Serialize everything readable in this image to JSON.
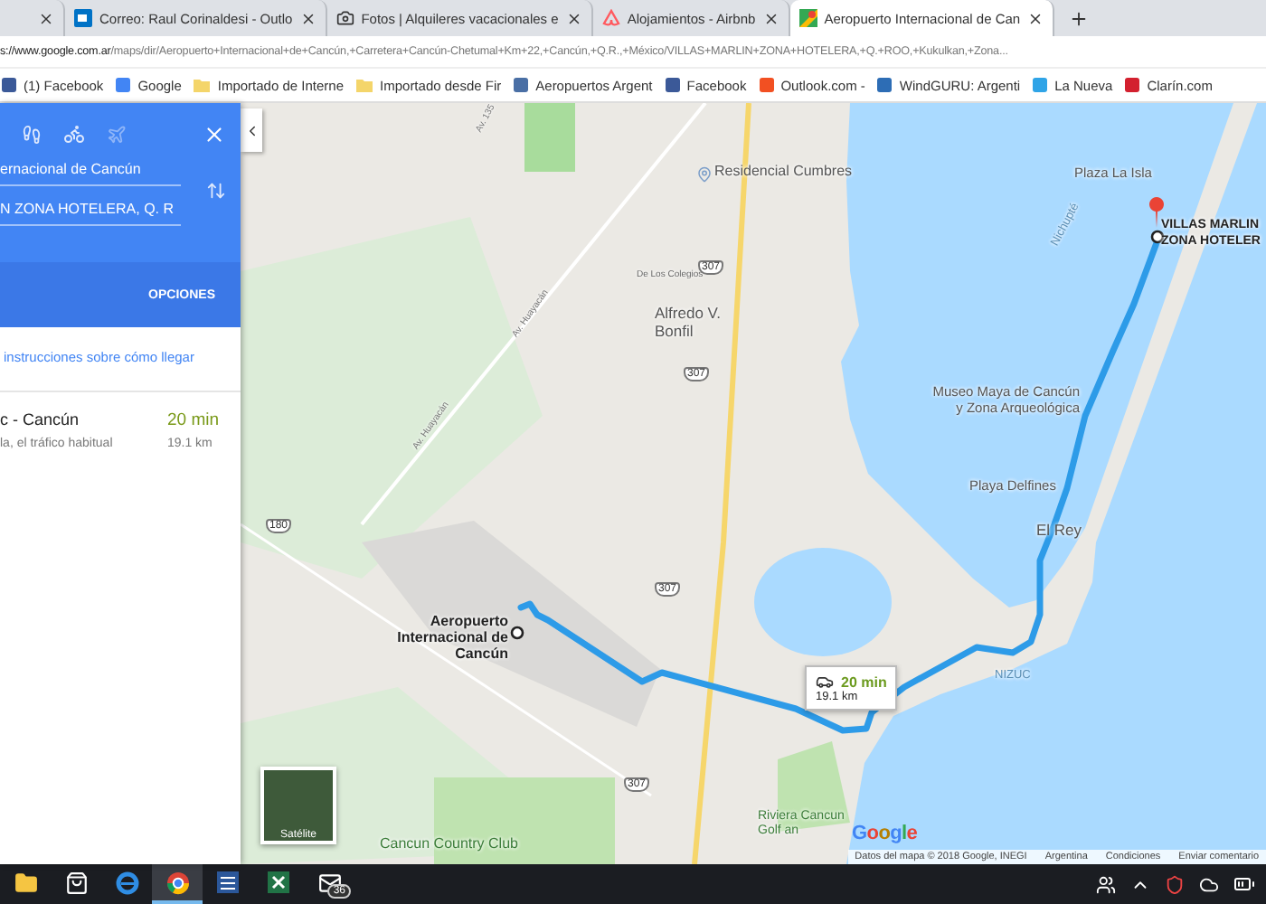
{
  "browser": {
    "tabs": [
      {
        "kind": "blank",
        "selected": false
      },
      {
        "kind": "mail",
        "title": "Correo: Raul Corinaldesi - Outlo",
        "selected": false
      },
      {
        "kind": "camera",
        "title": "Fotos | Alquileres vacacionales e",
        "selected": false
      },
      {
        "kind": "airbnb",
        "title": "Alojamientos - Airbnb",
        "selected": false
      },
      {
        "kind": "maps",
        "title": "Aeropuerto Internacional de Can",
        "selected": true
      }
    ],
    "address": {
      "host": "s://www.google.com.ar",
      "path": "/maps/dir/Aeropuerto+Internacional+de+Cancún,+Carretera+Cancún-Chetumal+Km+22,+Cancún,+Q.R.,+México/VILLAS+MARLIN+ZONA+HOTELERA,+Q.+ROO,+Kukulkan,+Zona..."
    },
    "bookmarks": [
      {
        "label": "(1) Facebook",
        "kind": "site",
        "color": "#3b5998"
      },
      {
        "label": "Google",
        "kind": "site",
        "color": "#4285f4"
      },
      {
        "label": "Importado de Interne",
        "kind": "folder",
        "color": "#f4d56a"
      },
      {
        "label": "Importado desde Fir",
        "kind": "folder",
        "color": "#f4d56a"
      },
      {
        "label": "Aeropuertos Argent",
        "kind": "site",
        "color": "#4a6fa5"
      },
      {
        "label": "Facebook",
        "kind": "site",
        "color": "#3b5998"
      },
      {
        "label": "Outlook.com -",
        "kind": "site",
        "color": "#f25022"
      },
      {
        "label": "WindGURU: Argenti",
        "kind": "site",
        "color": "#2d6db5"
      },
      {
        "label": "La Nueva",
        "kind": "site",
        "color": "#2fa4e7"
      },
      {
        "label": "Clarín.com",
        "kind": "site",
        "color": "#d3202f"
      }
    ]
  },
  "directions": {
    "modes": [
      {
        "kind": "walk",
        "selected": false
      },
      {
        "kind": "bike",
        "selected": false
      },
      {
        "kind": "plane",
        "selected": false
      }
    ],
    "origin": "ernacional de Cancún",
    "destination": "N ZONA HOTELERA, Q. R",
    "options": "OPCIONES",
    "send_link": "instrucciones sobre cómo llegar",
    "routes": [
      {
        "name": "c - Cancún",
        "duration": "20 min",
        "note": "la, el tráfico habitual",
        "distance": "19.1 km"
      }
    ]
  },
  "map": {
    "labels": [
      {
        "text": "Residencial Cumbres",
        "kind": "poi"
      },
      {
        "text": "Plaza La Isla",
        "kind": "poi-right"
      },
      {
        "text": "Nichupté",
        "kind": "water"
      },
      {
        "text": "Av. 135",
        "kind": "road"
      },
      {
        "text": "De Los Colegios",
        "kind": "road-flat"
      },
      {
        "text": "Alfredo V. Bonfil",
        "kind": "district"
      },
      {
        "text": "Av. Huayacán",
        "kind": "road"
      },
      {
        "text": "Av. Huayacán",
        "kind": "road"
      },
      {
        "text": "Museo Maya de Cancún y Zona Arqueológica",
        "kind": "poi-right"
      },
      {
        "text": "Playa Delfines",
        "kind": "poi-right"
      },
      {
        "text": "El Rey",
        "kind": "district"
      },
      {
        "text": "NIZUC",
        "kind": "water"
      },
      {
        "text": "Aeropuerto Internacional de Cancún",
        "kind": "place"
      },
      {
        "text": "Riviera Cancun Golf an",
        "kind": "park"
      },
      {
        "text": "Cancun Country Club",
        "kind": "park-right"
      }
    ],
    "destination": [
      "VILLAS MARLIN",
      "ZONA HOTELER"
    ],
    "shields": [
      "307",
      "307",
      "307",
      "307",
      "180"
    ],
    "popup": {
      "duration": "20 min",
      "distance": "19.1 km"
    },
    "satellite": "Satélite",
    "logo": "Google",
    "footer": [
      "Datos del mapa © 2018 Google, INEGI",
      "Argentina",
      "Condiciones",
      "Enviar comentario"
    ]
  },
  "taskbar": {
    "apps": [
      {
        "kind": "folder",
        "selected": false
      },
      {
        "kind": "store",
        "selected": false
      },
      {
        "kind": "edge",
        "selected": false
      },
      {
        "kind": "chrome",
        "selected": true
      },
      {
        "kind": "word",
        "selected": false
      },
      {
        "kind": "excel",
        "selected": false
      },
      {
        "kind": "mail",
        "selected": false
      }
    ],
    "mail_badge": "36"
  }
}
